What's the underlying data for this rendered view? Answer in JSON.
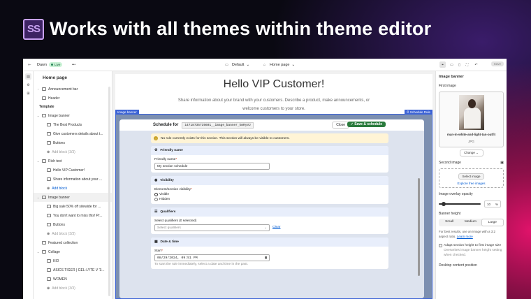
{
  "hero": {
    "logo_text": "SS",
    "title": "Works with all themes within theme editor"
  },
  "topbar": {
    "theme": "Dawn",
    "status": "Live",
    "template": "Default",
    "page": "Home page",
    "save": "Save"
  },
  "sidebar": {
    "title": "Home page",
    "rows": [
      {
        "label": "Announcement bar",
        "level": 0,
        "chev": true
      },
      {
        "label": "Header",
        "level": 0
      },
      {
        "section": "Template"
      },
      {
        "label": "Image banner",
        "level": 0,
        "chev": true,
        "open": true
      },
      {
        "label": "The Best Products",
        "level": 1
      },
      {
        "label": "Give customers details about t...",
        "level": 1
      },
      {
        "label": "Buttons",
        "level": 1
      },
      {
        "label": "Add block (3/3)",
        "level": 1,
        "disabled": true
      },
      {
        "label": "Rich text",
        "level": 0,
        "chev": true,
        "open": true
      },
      {
        "label": "Hello VIP Customer!",
        "level": 1
      },
      {
        "label": "Share information about your ...",
        "level": 1
      },
      {
        "label": "Add block",
        "level": 1,
        "add": true
      },
      {
        "label": "Image banner",
        "level": 0,
        "chev": true,
        "open": true,
        "selected": true
      },
      {
        "label": "Big sale 50% off sitewide for ...",
        "level": 1
      },
      {
        "label": "You don't want to miss this! Pr...",
        "level": 1
      },
      {
        "label": "Buttons",
        "level": 1
      },
      {
        "label": "Add block (3/3)",
        "level": 1,
        "disabled": true
      },
      {
        "label": "Featured collection",
        "level": 0
      },
      {
        "label": "Collage",
        "level": 0,
        "chev": true,
        "open": true
      },
      {
        "label": "KID",
        "level": 1
      },
      {
        "label": "ASICS TIGER | GEL-LYTE V '3...",
        "level": 1
      },
      {
        "label": "WOMEN",
        "level": 1
      },
      {
        "label": "Add block (3/3)",
        "level": 1,
        "disabled": true
      }
    ]
  },
  "preview": {
    "title": "Hello VIP Customer!",
    "text": "Share information about your brand with your customers. Describe a product, make announcements, or welcome customers to your store.",
    "tag_left": "Image banner",
    "tag_right": "Schedule Rule"
  },
  "modal": {
    "title": "Schedule for",
    "code": "14718735735601__image_banner_kmRyVJ",
    "close": "Close",
    "save": "Save & schedule",
    "alert": "No rule currently exists for this section. This section will always be visible to customers.",
    "friendly": {
      "header": "Friendly name",
      "label": "Friendly name",
      "value": "My section schedule"
    },
    "visibility": {
      "header": "Visibility",
      "label": "Element/section visibility",
      "opt1": "Visible",
      "opt2": "Hidden"
    },
    "qualifiers": {
      "header": "Qualifiers",
      "label": "Select qualifiers (0 selected)",
      "placeholder": "Select qualifiers",
      "clear": "Clear"
    },
    "datetime": {
      "header": "Date & time",
      "label": "Start",
      "value": "08/29/2024, 09:51 PM",
      "help": "To start the rule immediately, select a date and time in the past."
    }
  },
  "rpanel": {
    "title": "Image banner",
    "first_image": "First image",
    "file_name": "man-in-white-and-light-tan-outfit",
    "file_ext": "JPG",
    "change": "Change",
    "second_image": "Second image",
    "select_image": "Select image",
    "explore": "Explore free images",
    "overlay": "Image overlay opacity",
    "overlay_value": "10",
    "overlay_unit": "%",
    "banner_height": "Banner height",
    "heights": [
      "Small",
      "Medium",
      "Large"
    ],
    "height_note": "For best results, use an image with a 3:2 aspect ratio.",
    "learn": "Learn more",
    "adapt": "Adapt section height to first image size",
    "overwrite": "Overwrites image banner height setting when checked.",
    "desktop_pos": "Desktop content position"
  }
}
